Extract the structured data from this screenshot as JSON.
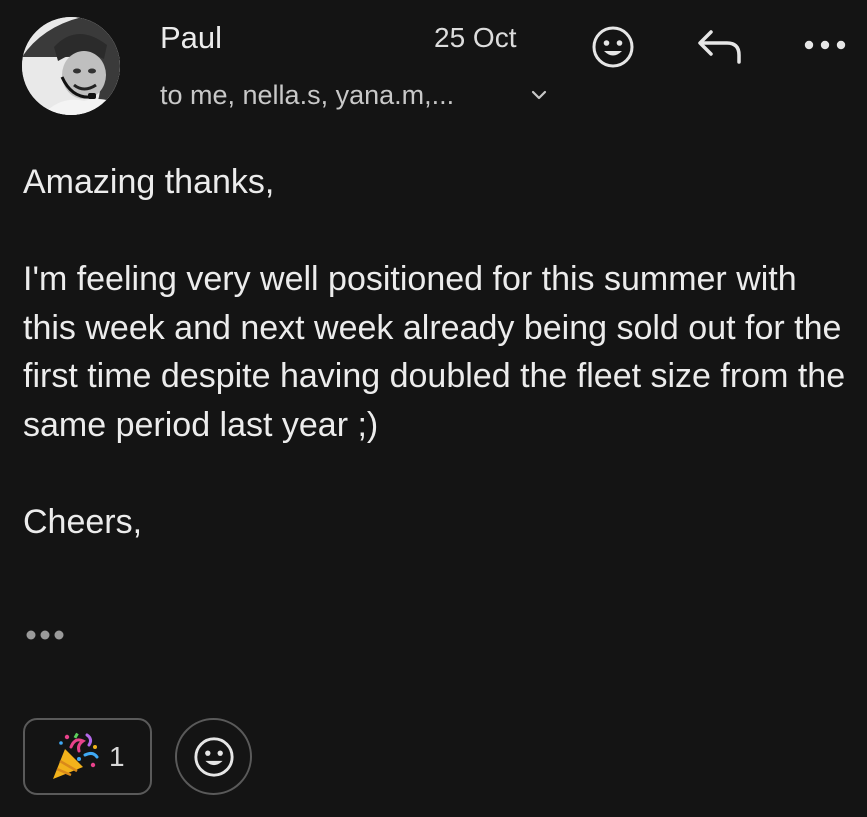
{
  "message": {
    "sender_name": "Paul",
    "date": "25 Oct",
    "recipients": "to me, nella.s, yana.m,...",
    "body_paragraphs": [
      "Amazing thanks,",
      "I'm feeling very well positioned for this summer with this week and next week already being sold out for the first time despite having doubled the fleet size from the same period last year ;)",
      "Cheers,"
    ]
  },
  "header_icons": {
    "react": "smiley-icon",
    "reply": "reply-arrow-icon",
    "more": "more-dots-icon",
    "expand_recipients": "chevron-down-icon"
  },
  "reactions": [
    {
      "emoji_icon": "party-popper-icon",
      "count": "1"
    }
  ],
  "colors": {
    "background": "#141414",
    "text": "#ececec",
    "secondary_text": "#c8c8c8",
    "chip_border": "#5a5a5a"
  }
}
